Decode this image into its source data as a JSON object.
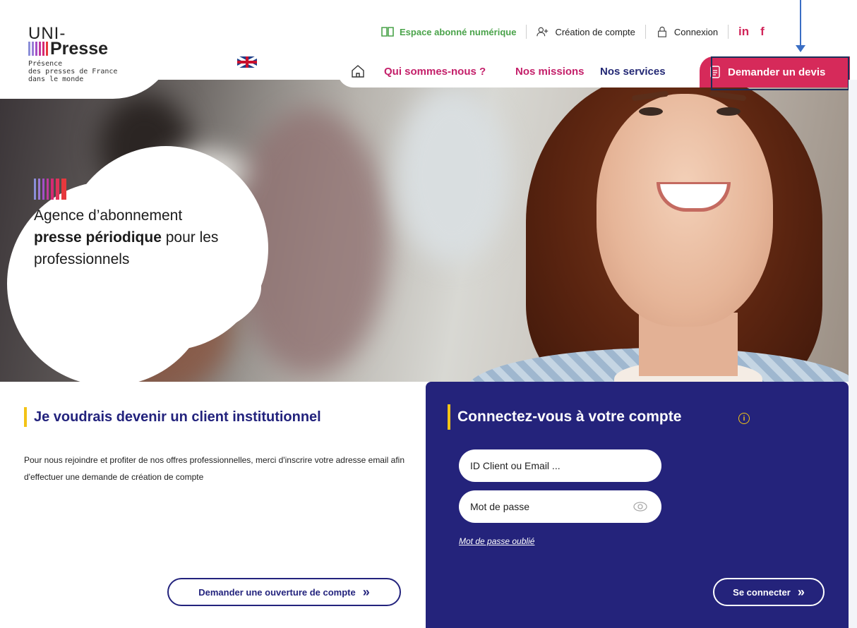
{
  "brand": {
    "logo_line1": "UNI-",
    "logo_line2": "Presse",
    "tagline_1": "Présence",
    "tagline_2": "des presses de France",
    "tagline_3": "dans le monde",
    "colors": [
      "#8b8fd8",
      "#a44ec7",
      "#d52a74",
      "#e6383d",
      "#23237d"
    ]
  },
  "topbar": {
    "subscriber_space": "Espace abonné numérique",
    "create_account": "Création de compte",
    "login": "Connexion",
    "linkedin": "in",
    "facebook": "f"
  },
  "nav": {
    "about": "Qui sommes-nous ?",
    "missions": "Nos missions",
    "services": "Nos services",
    "quote": "Demander un devis"
  },
  "hero": {
    "line1": "Agence d’abonnement",
    "bold": "presse périodique",
    "line2_rest": " pour les",
    "line3": "professionnels"
  },
  "left": {
    "title": "Je voudrais devenir un client institutionnel",
    "text": "Pour nous rejoindre et profiter de nos offres professionnelles, merci d'inscrire votre adresse email afin d'effectuer une demande de création de compte",
    "button": "Demander une ouverture de compte",
    "button_arrow": "»"
  },
  "login": {
    "title": "Connectez-vous à votre compte",
    "info": "i",
    "id_placeholder": "ID Client ou Email ...",
    "password_placeholder": "Mot de passe",
    "forgot": "Mot de passe oublié",
    "submit": "Se connecter",
    "submit_arrow": "»"
  },
  "colors": {
    "navy": "#24237b",
    "pink": "#d62a5a",
    "yellow": "#f3c316",
    "green": "#4aa34a"
  }
}
